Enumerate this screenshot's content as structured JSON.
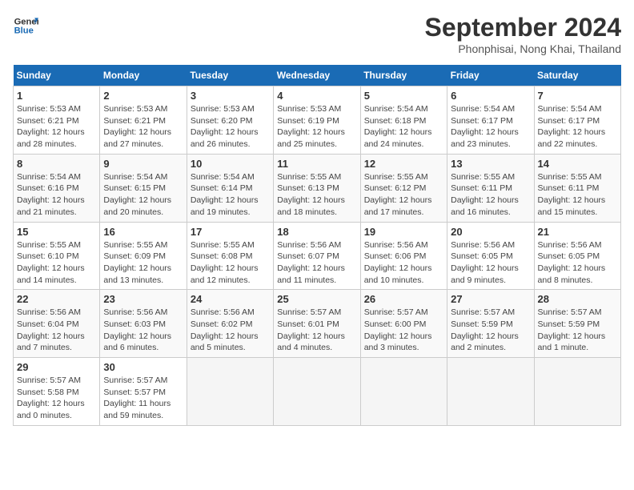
{
  "header": {
    "logo_line1": "General",
    "logo_line2": "Blue",
    "month": "September 2024",
    "location": "Phonphisai, Nong Khai, Thailand"
  },
  "weekdays": [
    "Sunday",
    "Monday",
    "Tuesday",
    "Wednesday",
    "Thursday",
    "Friday",
    "Saturday"
  ],
  "weeks": [
    [
      {
        "day": "1",
        "sunrise": "5:53 AM",
        "sunset": "6:21 PM",
        "daylight": "12 hours and 28 minutes."
      },
      {
        "day": "2",
        "sunrise": "5:53 AM",
        "sunset": "6:21 PM",
        "daylight": "12 hours and 27 minutes."
      },
      {
        "day": "3",
        "sunrise": "5:53 AM",
        "sunset": "6:20 PM",
        "daylight": "12 hours and 26 minutes."
      },
      {
        "day": "4",
        "sunrise": "5:53 AM",
        "sunset": "6:19 PM",
        "daylight": "12 hours and 25 minutes."
      },
      {
        "day": "5",
        "sunrise": "5:54 AM",
        "sunset": "6:18 PM",
        "daylight": "12 hours and 24 minutes."
      },
      {
        "day": "6",
        "sunrise": "5:54 AM",
        "sunset": "6:17 PM",
        "daylight": "12 hours and 23 minutes."
      },
      {
        "day": "7",
        "sunrise": "5:54 AM",
        "sunset": "6:17 PM",
        "daylight": "12 hours and 22 minutes."
      }
    ],
    [
      {
        "day": "8",
        "sunrise": "5:54 AM",
        "sunset": "6:16 PM",
        "daylight": "12 hours and 21 minutes."
      },
      {
        "day": "9",
        "sunrise": "5:54 AM",
        "sunset": "6:15 PM",
        "daylight": "12 hours and 20 minutes."
      },
      {
        "day": "10",
        "sunrise": "5:54 AM",
        "sunset": "6:14 PM",
        "daylight": "12 hours and 19 minutes."
      },
      {
        "day": "11",
        "sunrise": "5:55 AM",
        "sunset": "6:13 PM",
        "daylight": "12 hours and 18 minutes."
      },
      {
        "day": "12",
        "sunrise": "5:55 AM",
        "sunset": "6:12 PM",
        "daylight": "12 hours and 17 minutes."
      },
      {
        "day": "13",
        "sunrise": "5:55 AM",
        "sunset": "6:11 PM",
        "daylight": "12 hours and 16 minutes."
      },
      {
        "day": "14",
        "sunrise": "5:55 AM",
        "sunset": "6:11 PM",
        "daylight": "12 hours and 15 minutes."
      }
    ],
    [
      {
        "day": "15",
        "sunrise": "5:55 AM",
        "sunset": "6:10 PM",
        "daylight": "12 hours and 14 minutes."
      },
      {
        "day": "16",
        "sunrise": "5:55 AM",
        "sunset": "6:09 PM",
        "daylight": "12 hours and 13 minutes."
      },
      {
        "day": "17",
        "sunrise": "5:55 AM",
        "sunset": "6:08 PM",
        "daylight": "12 hours and 12 minutes."
      },
      {
        "day": "18",
        "sunrise": "5:56 AM",
        "sunset": "6:07 PM",
        "daylight": "12 hours and 11 minutes."
      },
      {
        "day": "19",
        "sunrise": "5:56 AM",
        "sunset": "6:06 PM",
        "daylight": "12 hours and 10 minutes."
      },
      {
        "day": "20",
        "sunrise": "5:56 AM",
        "sunset": "6:05 PM",
        "daylight": "12 hours and 9 minutes."
      },
      {
        "day": "21",
        "sunrise": "5:56 AM",
        "sunset": "6:05 PM",
        "daylight": "12 hours and 8 minutes."
      }
    ],
    [
      {
        "day": "22",
        "sunrise": "5:56 AM",
        "sunset": "6:04 PM",
        "daylight": "12 hours and 7 minutes."
      },
      {
        "day": "23",
        "sunrise": "5:56 AM",
        "sunset": "6:03 PM",
        "daylight": "12 hours and 6 minutes."
      },
      {
        "day": "24",
        "sunrise": "5:56 AM",
        "sunset": "6:02 PM",
        "daylight": "12 hours and 5 minutes."
      },
      {
        "day": "25",
        "sunrise": "5:57 AM",
        "sunset": "6:01 PM",
        "daylight": "12 hours and 4 minutes."
      },
      {
        "day": "26",
        "sunrise": "5:57 AM",
        "sunset": "6:00 PM",
        "daylight": "12 hours and 3 minutes."
      },
      {
        "day": "27",
        "sunrise": "5:57 AM",
        "sunset": "5:59 PM",
        "daylight": "12 hours and 2 minutes."
      },
      {
        "day": "28",
        "sunrise": "5:57 AM",
        "sunset": "5:59 PM",
        "daylight": "12 hours and 1 minute."
      }
    ],
    [
      {
        "day": "29",
        "sunrise": "5:57 AM",
        "sunset": "5:58 PM",
        "daylight": "12 hours and 0 minutes."
      },
      {
        "day": "30",
        "sunrise": "5:57 AM",
        "sunset": "5:57 PM",
        "daylight": "11 hours and 59 minutes."
      },
      null,
      null,
      null,
      null,
      null
    ]
  ]
}
